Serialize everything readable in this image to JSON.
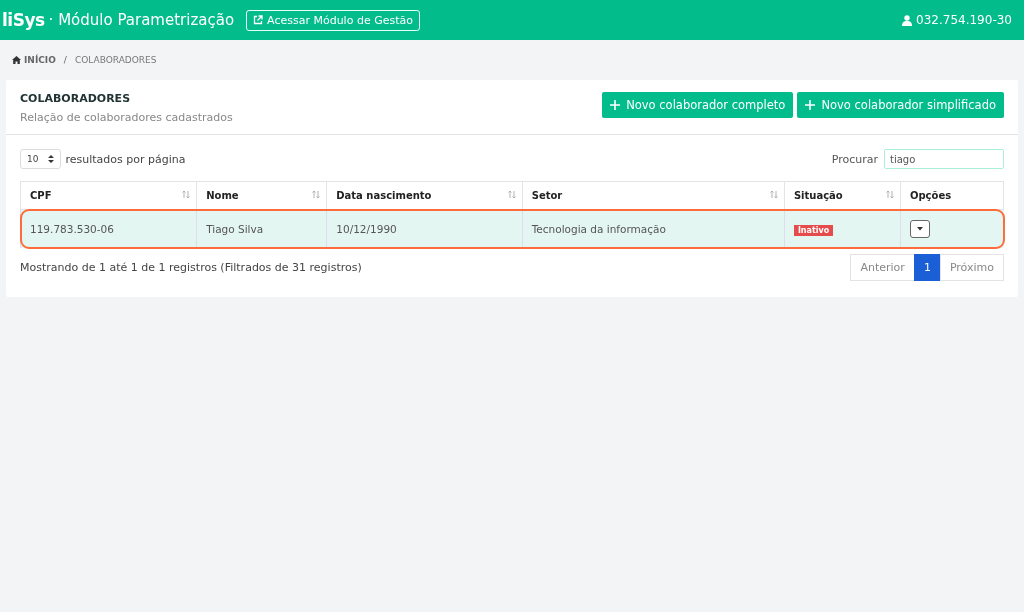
{
  "header": {
    "brand": "liSys",
    "title": "· Módulo Parametrização",
    "link_button": "Acessar Módulo de Gestão",
    "user": "032.754.190-30"
  },
  "breadcrumb": {
    "items": [
      "INÍCIO",
      "COLABORADORES"
    ],
    "separator": "/"
  },
  "card": {
    "title": "COLABORADORES",
    "subtitle": "Relação de colaboradores cadastrados",
    "buttons": [
      {
        "label": "Novo colaborador completo"
      },
      {
        "label": "Novo colaborador simplificado"
      }
    ]
  },
  "page_size": {
    "value": "10",
    "label": "resultados por página"
  },
  "search": {
    "label": "Procurar",
    "value": "tiago"
  },
  "table": {
    "columns": [
      {
        "label": "CPF",
        "sortable": true
      },
      {
        "label": "Nome",
        "sortable": true
      },
      {
        "label": "Data nascimento",
        "sortable": true
      },
      {
        "label": "Setor",
        "sortable": true
      },
      {
        "label": "Situação",
        "sortable": true
      },
      {
        "label": "Opções",
        "sortable": false
      }
    ],
    "rows": [
      {
        "highlighted": true,
        "cells": [
          "119.783.530-06",
          "Tiago Silva",
          "10/12/1990",
          "Tecnologia da informação"
        ],
        "status": {
          "label": "Inativo",
          "kind": "inactive"
        }
      }
    ]
  },
  "info": "Mostrando de 1 até 1 de 1 registros (Filtrados de 31 registros)",
  "pagination": [
    {
      "label": "Anterior",
      "selected": false
    },
    {
      "label": "1",
      "selected": true
    },
    {
      "label": "Próximo",
      "selected": false
    }
  ]
}
